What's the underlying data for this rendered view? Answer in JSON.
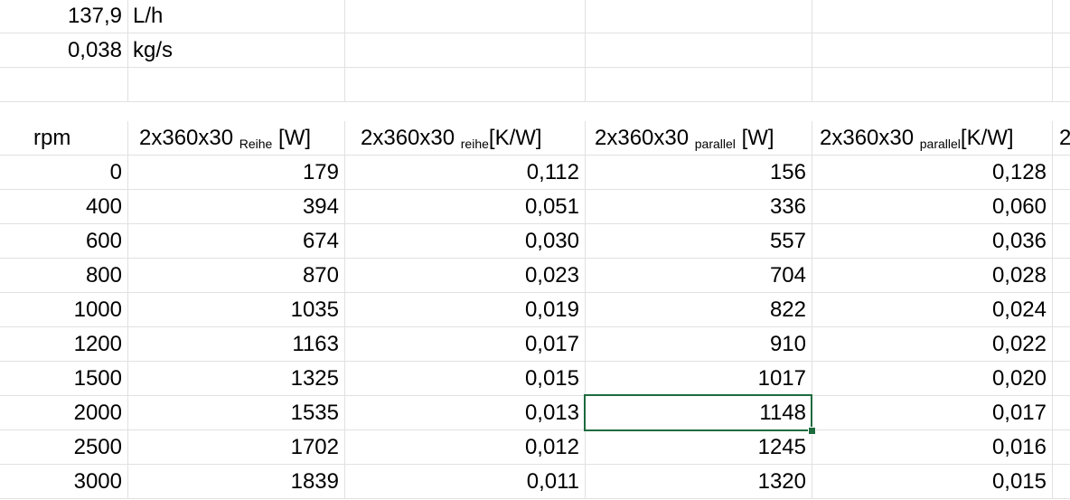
{
  "flow": {
    "value1": "137,9",
    "unit1": "L/h",
    "value2": "0,038",
    "unit2": "kg/s"
  },
  "table": {
    "headers": {
      "rpm": "rpm",
      "h1_main": "2x360x30 ",
      "h1_sub": "Reihe",
      "h1_unit": " [W]",
      "h2_main": "2x360x30 ",
      "h2_sub": "reihe",
      "h2_unit": "[K/W]",
      "h3_main": "2x360x30 ",
      "h3_sub": "parallel",
      "h3_unit": " [W]",
      "h4_main": "2x360x30 ",
      "h4_sub": "parallel",
      "h4_unit": "[K/W]",
      "h5_main": "2"
    },
    "rows": [
      {
        "rpm": "0",
        "reihe_w": "179",
        "reihe_kw": "0,112",
        "parallel_w": "156",
        "parallel_kw": "0,128"
      },
      {
        "rpm": "400",
        "reihe_w": "394",
        "reihe_kw": "0,051",
        "parallel_w": "336",
        "parallel_kw": "0,060"
      },
      {
        "rpm": "600",
        "reihe_w": "674",
        "reihe_kw": "0,030",
        "parallel_w": "557",
        "parallel_kw": "0,036"
      },
      {
        "rpm": "800",
        "reihe_w": "870",
        "reihe_kw": "0,023",
        "parallel_w": "704",
        "parallel_kw": "0,028"
      },
      {
        "rpm": "1000",
        "reihe_w": "1035",
        "reihe_kw": "0,019",
        "parallel_w": "822",
        "parallel_kw": "0,024"
      },
      {
        "rpm": "1200",
        "reihe_w": "1163",
        "reihe_kw": "0,017",
        "parallel_w": "910",
        "parallel_kw": "0,022"
      },
      {
        "rpm": "1500",
        "reihe_w": "1325",
        "reihe_kw": "0,015",
        "parallel_w": "1017",
        "parallel_kw": "0,020"
      },
      {
        "rpm": "2000",
        "reihe_w": "1535",
        "reihe_kw": "0,013",
        "parallel_w": "1148",
        "parallel_kw": "0,017"
      },
      {
        "rpm": "2500",
        "reihe_w": "1702",
        "reihe_kw": "0,012",
        "parallel_w": "1245",
        "parallel_kw": "0,016"
      },
      {
        "rpm": "3000",
        "reihe_w": "1839",
        "reihe_kw": "0,011",
        "parallel_w": "1320",
        "parallel_kw": "0,015"
      }
    ]
  },
  "selection": {
    "active_cell_value": "1148",
    "border_color": "#1e6b3e"
  },
  "colors": {
    "gridline": "#e1e1e1",
    "selection": "#1e6b3e"
  }
}
